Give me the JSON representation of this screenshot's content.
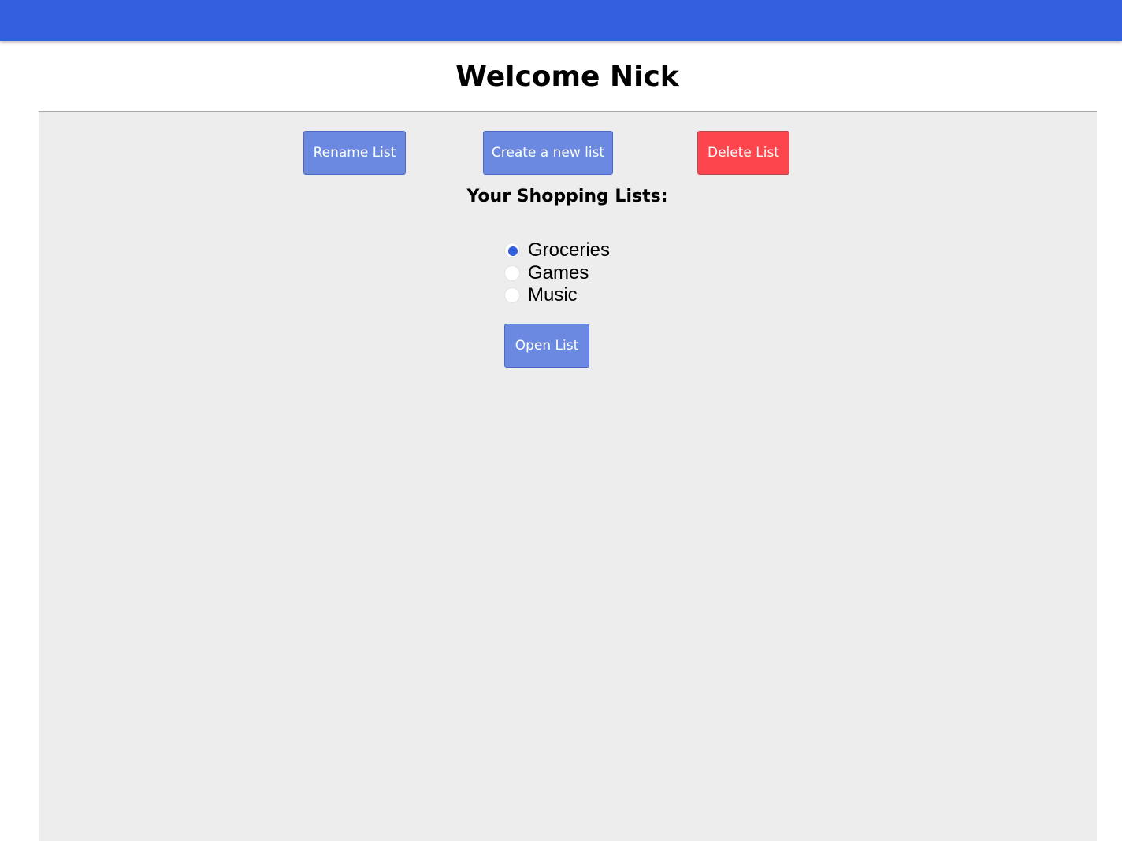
{
  "header": {
    "title": "Welcome Nick"
  },
  "toolbar": {
    "rename_label": "Rename List",
    "create_label": "Create a new list",
    "delete_label": "Delete List"
  },
  "lists": {
    "heading": "Your Shopping Lists:",
    "items": [
      {
        "label": "Groceries",
        "checked": true
      },
      {
        "label": "Games",
        "checked": false
      },
      {
        "label": "Music",
        "checked": false
      }
    ],
    "open_label": "Open List"
  },
  "colors": {
    "accent": "#325fdd",
    "button": "#6b89e0",
    "danger": "#fc454c",
    "panel": "#ededed"
  }
}
